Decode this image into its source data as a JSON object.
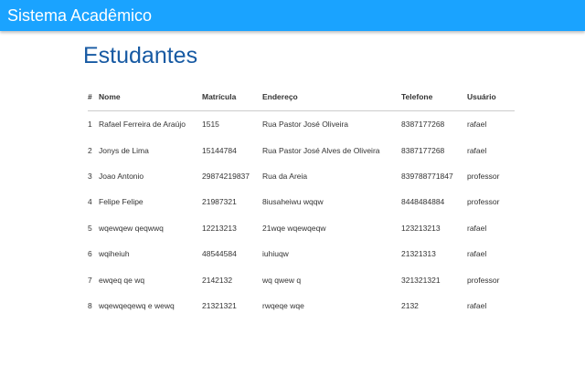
{
  "app": {
    "title": "Sistema Acadêmico"
  },
  "page": {
    "title": "Estudantes"
  },
  "table": {
    "headers": [
      "#",
      "Nome",
      "Matrícula",
      "Endereço",
      "Telefone",
      "Usuário"
    ],
    "rows": [
      [
        "1",
        "Rafael Ferreira de Araújo",
        "1515",
        "Rua Pastor José Oliveira",
        "8387177268",
        "rafael"
      ],
      [
        "2",
        "Jonys de Lima",
        "15144784",
        "Rua Pastor José Alves de Oliveira",
        "8387177268",
        "rafael"
      ],
      [
        "3",
        "Joao Antonio",
        "29874219837",
        "Rua da Areia",
        "839788771847",
        "professor"
      ],
      [
        "4",
        "Felipe Felipe",
        "21987321",
        "8iusaheiwu wqqw",
        "8448484884",
        "professor"
      ],
      [
        "5",
        "wqewqew qeqwwq",
        "12213213",
        "21wqe wqewqeqw",
        "123213213",
        "rafael"
      ],
      [
        "6",
        "wqiheiuh",
        "48544584",
        "iuhiuqw",
        "21321313",
        "rafael"
      ],
      [
        "7",
        "ewqeq qe wq",
        "2142132",
        "wq qwew q",
        "321321321",
        "professor"
      ],
      [
        "8",
        "wqewqeqewq e wewq",
        "21321321",
        "rwqeqe wqe",
        "2132",
        "rafael"
      ]
    ]
  },
  "colors": {
    "appbar": "#1aa3ff",
    "title": "#175aa3"
  }
}
